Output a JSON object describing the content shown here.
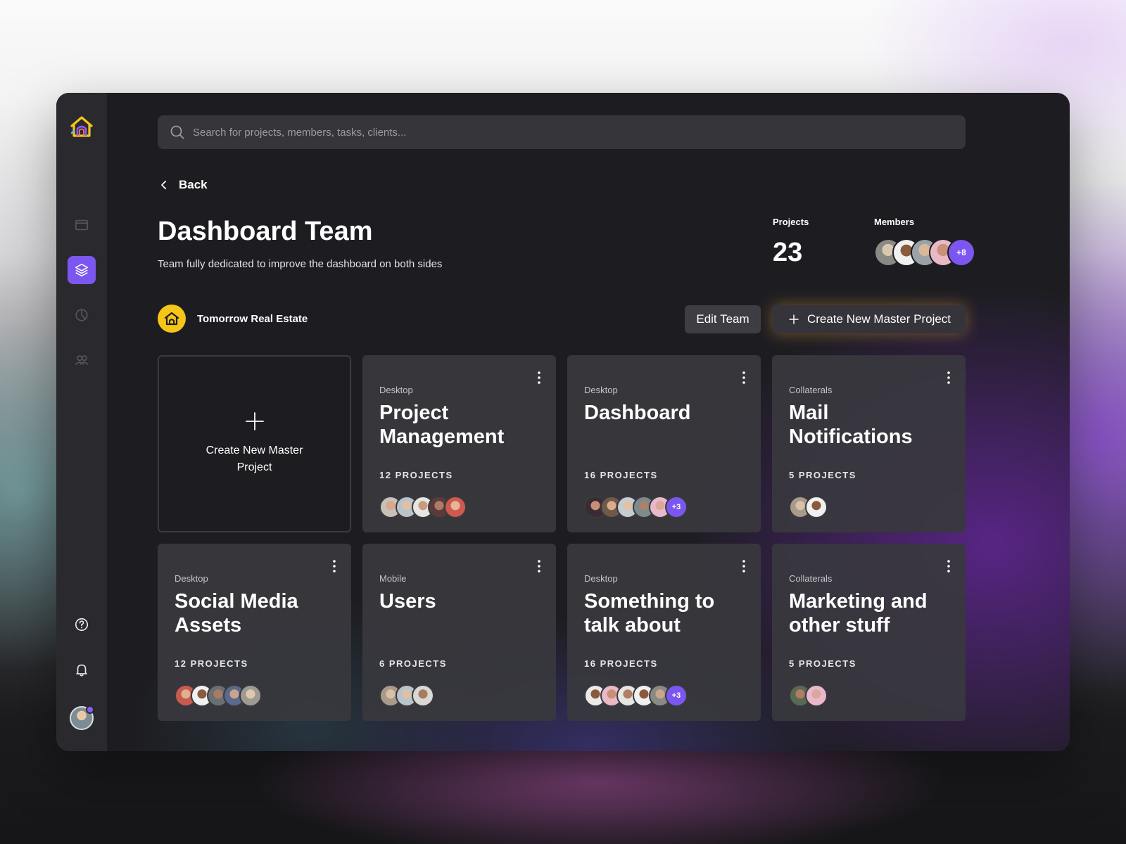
{
  "search": {
    "placeholder": "Search for projects, members, tasks, clients..."
  },
  "nav": {
    "back_label": "Back"
  },
  "team": {
    "title": "Dashboard Team",
    "subtitle": "Team fully dedicated to improve the dashboard on both sides",
    "projects_label": "Projects",
    "projects_count": "23",
    "members_label": "Members",
    "members_more": "+8",
    "company": "Tomorrow Real Estate"
  },
  "actions": {
    "edit_label": "Edit Team",
    "create_label": "Create New Master Project"
  },
  "create_card": {
    "label": "Create New Master Project"
  },
  "cards": [
    {
      "category": "Desktop",
      "title": "Project Management",
      "count": "12 PROJECTS",
      "more": ""
    },
    {
      "category": "Desktop",
      "title": "Dashboard",
      "count": "16 PROJECTS",
      "more": "+3"
    },
    {
      "category": "Collaterals",
      "title": "Mail Notifications",
      "count": "5 PROJECTS",
      "more": ""
    },
    {
      "category": "Desktop",
      "title": "Social Media Assets",
      "count": "12 PROJECTS",
      "more": ""
    },
    {
      "category": "Mobile",
      "title": "Users",
      "count": "6 PROJECTS",
      "more": ""
    },
    {
      "category": "Desktop",
      "title": "Something to talk about",
      "count": "16 PROJECTS",
      "more": "+3"
    },
    {
      "category": "Collaterals",
      "title": "Marketing and other stuff",
      "count": "5 PROJECTS",
      "more": ""
    }
  ],
  "colors": {
    "accent": "#7b57f0",
    "brand_yellow": "#f5c518",
    "background": "#1d1d21",
    "sidebar": "#2a2a2e",
    "card": "#38383e"
  },
  "icons": {
    "sidebar": [
      "home-logo-icon",
      "window-icon",
      "layers-icon",
      "pie-chart-icon",
      "users-icon",
      "help-icon",
      "bell-icon"
    ],
    "search": "search-icon",
    "back": "chevron-left-icon",
    "card_menu": "more-vertical-icon",
    "create": "plus-icon"
  }
}
